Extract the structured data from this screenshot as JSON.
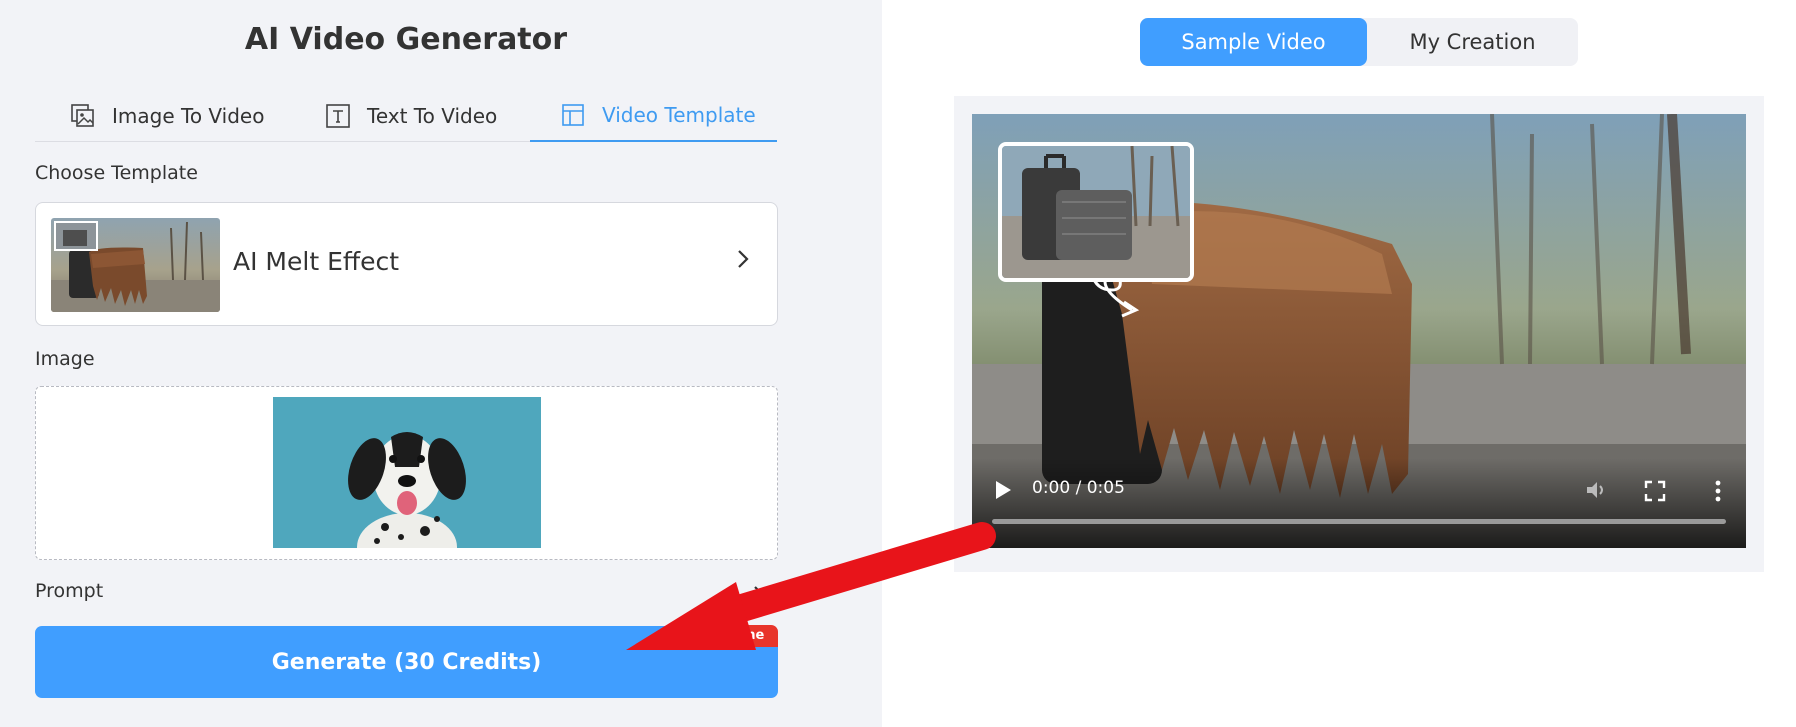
{
  "title": "AI Video Generator",
  "tabs": [
    {
      "label": "Image To Video",
      "icon": "image-to-video-icon"
    },
    {
      "label": "Text To Video",
      "icon": "text-icon"
    },
    {
      "label": "Video Template",
      "icon": "template-icon",
      "active": true
    }
  ],
  "choose_template": {
    "label": "Choose Template",
    "selected": "AI Melt Effect",
    "thumbnail_icon": "suitcase-melt-thumbnail"
  },
  "image": {
    "label": "Image",
    "preview": "dalmatian-dog-photo"
  },
  "prompt": {
    "label": "Prompt"
  },
  "generate": {
    "label": "Generate (30 Credits)",
    "badge": "me"
  },
  "segment": {
    "sample": "Sample Video",
    "mine": "My Creation",
    "active": "sample"
  },
  "video": {
    "time": "0:00 / 0:05",
    "progress": 0
  },
  "colors": {
    "accent": "#409eff",
    "tab_active": "#3f9bf1",
    "badge": "#e8342a",
    "arrow": "#e8141a",
    "panel_bg": "#f2f3f7"
  }
}
